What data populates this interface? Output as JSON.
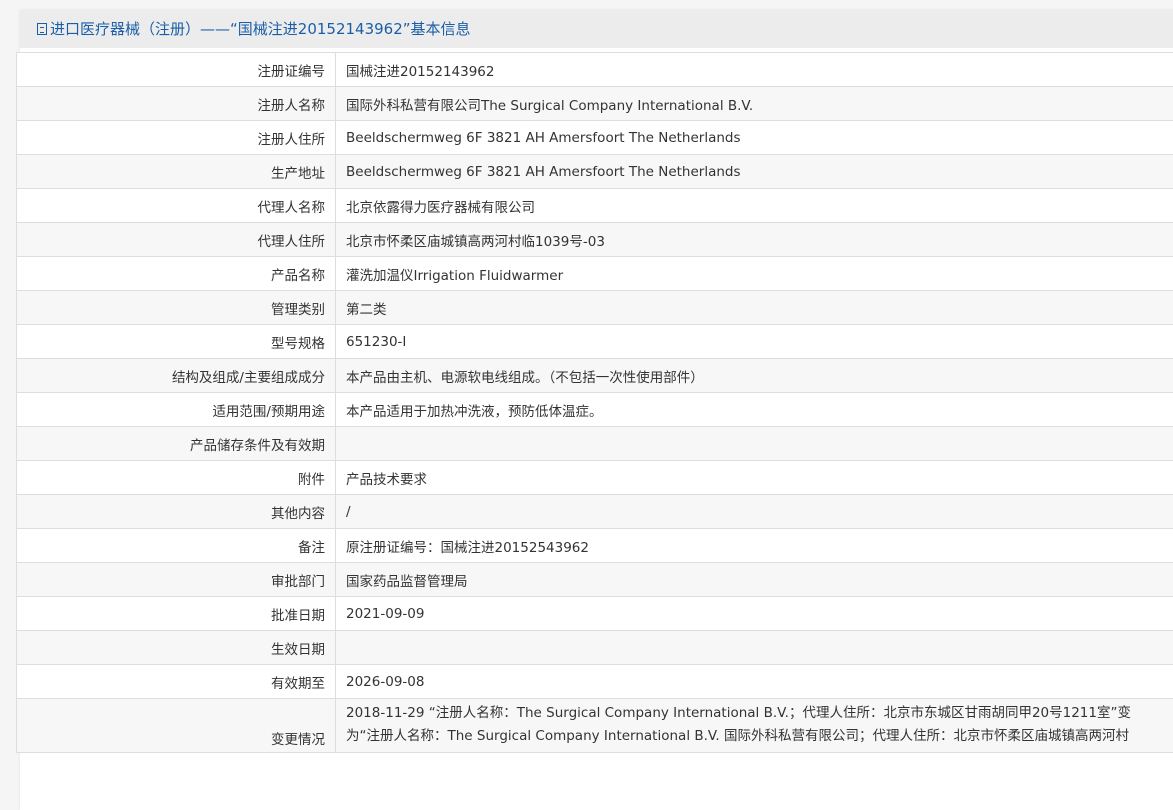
{
  "header": {
    "title": "进口医疗器械（注册）——“国械注进20152143962”基本信息",
    "icon": "document-icon",
    "accent": "#1a5ea8"
  },
  "rows": [
    {
      "label": "注册证编号",
      "value": "国械注进20152143962"
    },
    {
      "label": "注册人名称",
      "value": "国际外科私营有限公司The Surgical Company International B.V."
    },
    {
      "label": "注册人住所",
      "value": "Beeldschermweg 6F 3821 AH Amersfoort The Netherlands"
    },
    {
      "label": "生产地址",
      "value": "Beeldschermweg 6F 3821 AH Amersfoort The Netherlands"
    },
    {
      "label": "代理人名称",
      "value": "北京依露得力医疗器械有限公司"
    },
    {
      "label": "代理人住所",
      "value": "北京市怀柔区庙城镇高两河村临1039号-03"
    },
    {
      "label": "产品名称",
      "value": "灌洗加温仪Irrigation Fluidwarmer"
    },
    {
      "label": "管理类别",
      "value": "第二类"
    },
    {
      "label": "型号规格",
      "value": "651230-I"
    },
    {
      "label": "结构及组成/主要组成成分",
      "value": "本产品由主机、电源软电线组成。（不包括一次性使用部件）"
    },
    {
      "label": "适用范围/预期用途",
      "value": "本产品适用于加热冲洗液，预防低体温症。"
    },
    {
      "label": "产品储存条件及有效期",
      "value": ""
    },
    {
      "label": "附件",
      "value": "产品技术要求"
    },
    {
      "label": "其他内容",
      "value": "/"
    },
    {
      "label": "备注",
      "value": "原注册证编号：国械注进20152543962"
    },
    {
      "label": "审批部门",
      "value": "国家药品监督管理局"
    },
    {
      "label": "批准日期",
      "value": "2021-09-09"
    },
    {
      "label": "生效日期",
      "value": ""
    },
    {
      "label": "有效期至",
      "value": "2026-09-08"
    }
  ],
  "change": {
    "label": "变更情况",
    "line1": "2018-11-29 “注册人名称：The Surgical Company International B.V.；代理人住所：北京市东城区甘雨胡同甲20号1211室”变",
    "line2": "为“注册人名称：The Surgical Company International B.V. 国际外科私营有限公司；代理人住所：北京市怀柔区庙城镇高两河村"
  }
}
